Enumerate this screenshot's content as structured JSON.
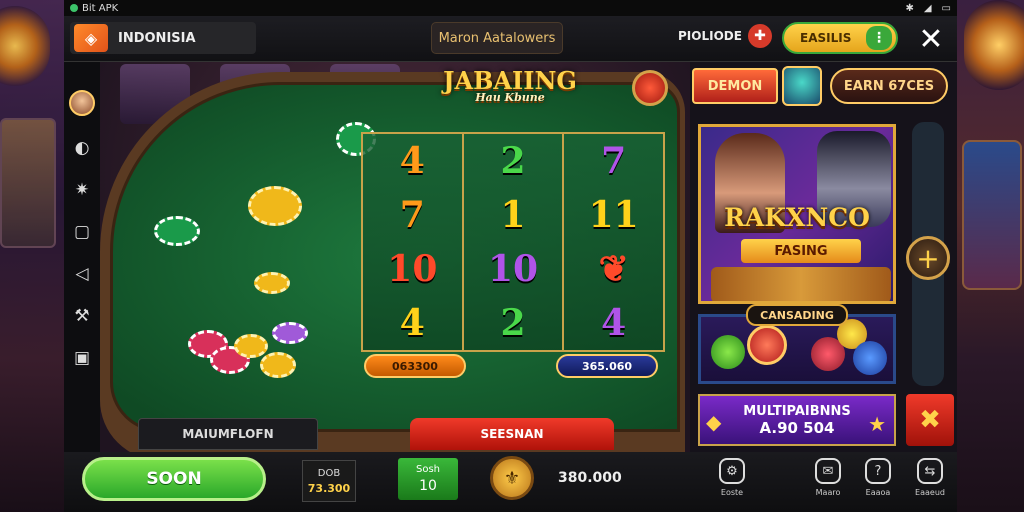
{
  "statusbar": {
    "app_name": "Bit APK"
  },
  "topbar": {
    "region_label": "INDONISIA",
    "announcement": "Maron Aatalowers",
    "profile_label": "PIOLIODE",
    "balance_label": "EASILIS",
    "plus_icon": "plus-icon",
    "close_icon": "close-icon"
  },
  "game": {
    "logo_title": "JABAIING",
    "logo_subtitle": "Hau Kbune",
    "reels": [
      [
        "4",
        "7",
        "10",
        "4"
      ],
      [
        "2",
        "1",
        "10",
        "2"
      ],
      [
        "7",
        "11",
        "leaf",
        "4"
      ]
    ],
    "pill_left_value": "063300",
    "pill_right_value": "365.060",
    "left_button_label": "MAIUMFLOFN",
    "right_button_label": "SEESNAN"
  },
  "right_panel": {
    "demon_label": "DEMON",
    "earn_label": "EARN 67CES",
    "banner_title": "RAKXNCO",
    "banner_subtitle": "FASING",
    "sub_label": "CANSADING",
    "multiplier_label": "MULTIPAIBNNS",
    "multiplier_value": "A.90 504"
  },
  "bottombar": {
    "soon_label": "SOON",
    "bet_label": "DOB",
    "bet_value": "73.300",
    "lines_label": "Sosh",
    "lines_value": "10",
    "total_value": "380.000",
    "nav": [
      {
        "label": "Eoste",
        "icon": "settings-icon"
      },
      {
        "label": "Maaro",
        "icon": "chat-icon"
      },
      {
        "label": "Eaaoa",
        "icon": "help-icon"
      },
      {
        "label": "Eaaeud",
        "icon": "share-icon"
      }
    ]
  },
  "colors": {
    "felt": "#1e7a3e",
    "accent_gold": "#ffd24a",
    "spin_green": "#2aa82a",
    "danger_red": "#f03a2a"
  }
}
